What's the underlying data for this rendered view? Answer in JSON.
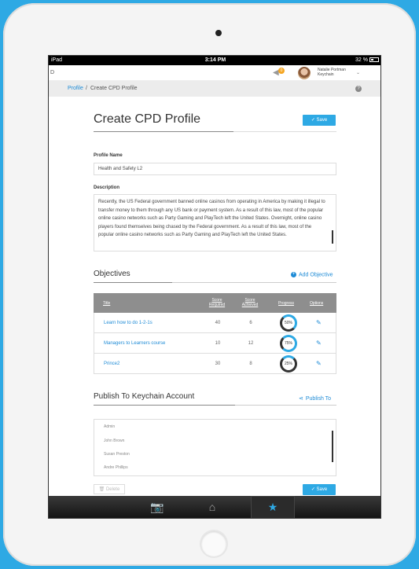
{
  "status_bar": {
    "carrier": "iPad",
    "time": "3:14 PM",
    "battery": "32 %"
  },
  "top_bar": {
    "app_name": "D",
    "notification_count": "0",
    "user_name": "Natalie Portman",
    "user_org": "Keychain"
  },
  "breadcrumb": {
    "link": "Profile",
    "separator": "/",
    "current": "Create CPD Profile"
  },
  "page": {
    "title": "Create CPD Profile",
    "save_label": "✓  Save"
  },
  "profile_name": {
    "label": "Profile Name",
    "value": "Health and Safety L2"
  },
  "description": {
    "label": "Description",
    "value": "Recently, the US Federal government banned online casinos from operating in America by making it illegal to transfer money to them through any US bank or payment system. As a result of this law, most of the popular online casino networks such as Party Gaming and PlayTech left the United States. Overnight, online casino players found themselves being chased by the Federal government. As a result of this law, most of the popular online casino networks such as Party Gaming and PlayTech left the United States."
  },
  "objectives": {
    "title": "Objectives",
    "add_label": "Add Objective",
    "columns": {
      "title": "Title",
      "score_required": "Score Required",
      "score_achieved": "Score Achieved",
      "progress": "Progress",
      "options": "Options"
    },
    "rows": [
      {
        "title": "Learn how to do 1-2-1s",
        "required": "40",
        "achieved": "6",
        "progress": "50%",
        "progress_value": 0.5
      },
      {
        "title": "Managers to Learners course",
        "required": "10",
        "achieved": "12",
        "progress": "75%",
        "progress_value": 0.75
      },
      {
        "title": "Prince2",
        "required": "30",
        "achieved": "8",
        "progress": "25%",
        "progress_value": 0.25
      }
    ]
  },
  "publish": {
    "title": "Publish To Keychain Account",
    "action_label": "Publish To",
    "accounts": [
      "Admin",
      "John Brown",
      "Susan Preston",
      "Andre Phillips"
    ]
  },
  "footer": {
    "delete_label": "Delete",
    "save_label": "✓  Save"
  },
  "tabbar": {
    "camera": "📷",
    "home": "⌂",
    "star": "★"
  },
  "colors": {
    "accent": "#2ea9e4",
    "link": "#1e8bd6"
  }
}
